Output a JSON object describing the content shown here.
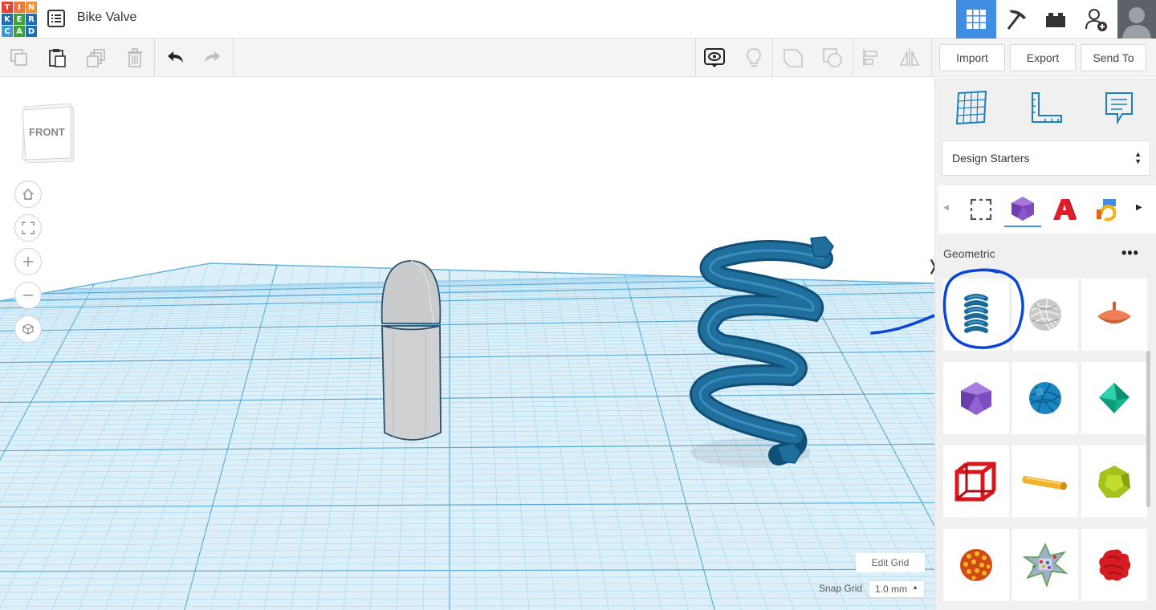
{
  "header": {
    "logo_letters": [
      "T",
      "I",
      "N",
      "K",
      "E",
      "R",
      "C",
      "A",
      "D"
    ],
    "logo_colors": [
      "#e83f33",
      "#f0773a",
      "#f0773a",
      "#f08f33",
      "#1b6db5",
      "#3da23c",
      "#1b6db5",
      "#3f99d5",
      "#3da23c"
    ],
    "design_title": "Bike Valve",
    "icons": [
      "grid-view-icon",
      "pickaxe-icon",
      "bricks-icon",
      "add-user-icon"
    ],
    "accent": "#3f8ee3"
  },
  "toolbar": {
    "left_tools": [
      "copy-icon",
      "paste-icon",
      "duplicate-icon",
      "delete-icon",
      "undo-icon",
      "redo-icon"
    ],
    "right_tools": [
      "notes-toggle-icon",
      "light-icon",
      "group-icon",
      "ungroup-icon",
      "align-icon",
      "mirror-icon"
    ],
    "import_label": "Import",
    "export_label": "Export",
    "send_to_label": "Send To"
  },
  "viewport": {
    "view_cube_label": "FRONT",
    "edit_grid_label": "Edit Grid",
    "snap_grid_label": "Snap Grid",
    "snap_grid_value": "1.0 mm",
    "collapse_glyph": "❭"
  },
  "panel": {
    "library_select": "Design Starters",
    "section_title": "Geometric",
    "more_label": "•••",
    "shapes": [
      "Spring",
      "Sphere scribble",
      "Cone top",
      "Icosahedron",
      "Sphere wire",
      "Octahedron",
      "Cube frame",
      "Cylinder rod",
      "Dodecahedron",
      "Sphere dots",
      "Crystal",
      "Blob"
    ]
  }
}
